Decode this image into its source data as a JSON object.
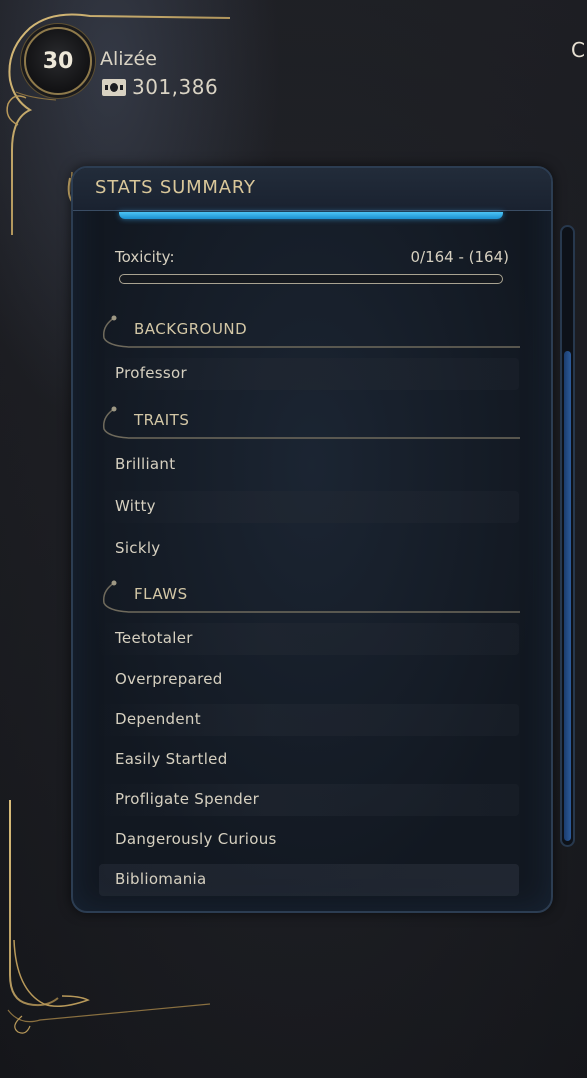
{
  "header": {
    "level": "30",
    "player_name": "Alizée",
    "currency_icon": "bits-currency-icon",
    "currency_value": "301,386",
    "corner_letter": "C"
  },
  "panel": {
    "title": "STATS SUMMARY",
    "toxicity": {
      "label": "Toxicity:",
      "value": "0/164 - (164)",
      "fill_fraction": 0
    },
    "sections": [
      {
        "title": "BACKGROUND",
        "items": [
          "Professor"
        ]
      },
      {
        "title": "TRAITS",
        "items": [
          "Brilliant",
          "Witty",
          "Sickly"
        ]
      },
      {
        "title": "FLAWS",
        "items": [
          "Teetotaler",
          "Overprepared",
          "Dependent",
          "Easily Startled",
          "Profligate Spender",
          "Dangerously Curious",
          "Bibliomania"
        ]
      }
    ]
  },
  "colors": {
    "accent_gold": "#b8995a",
    "accent_blue": "#3bb3ea",
    "panel_bg": "#141a23"
  }
}
